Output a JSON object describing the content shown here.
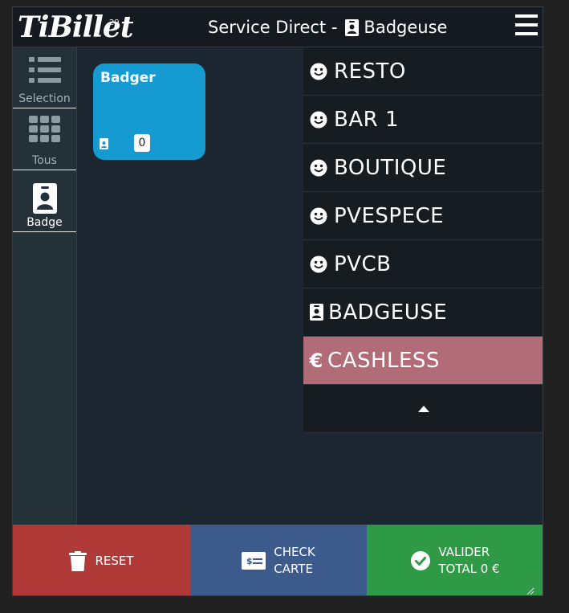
{
  "header": {
    "logo_text": "TiBillet",
    "logo_sup": "29",
    "title_prefix": "Service Direct -",
    "title_suffix": "Badgeuse",
    "menu_icon": "hamburger-menu-icon"
  },
  "sidebar": {
    "items": [
      {
        "label": "Selection",
        "icon": "list-icon",
        "active": false
      },
      {
        "label": "Tous",
        "icon": "grid-icon",
        "active": false
      },
      {
        "label": "Badge",
        "icon": "badge-icon",
        "active": true
      }
    ]
  },
  "tile": {
    "name": "Badger",
    "icon": "badge-icon",
    "count": "0",
    "color": "#159ad1"
  },
  "list": {
    "items": [
      {
        "label": "RESTO",
        "icon": "smile-icon"
      },
      {
        "label": "BAR 1",
        "icon": "smile-icon"
      },
      {
        "label": "BOUTIQUE",
        "icon": "smile-icon"
      },
      {
        "label": "PVESPECE",
        "icon": "smile-icon"
      },
      {
        "label": "PVCB",
        "icon": "smile-icon"
      },
      {
        "label": "BADGEUSE",
        "icon": "badge-icon"
      },
      {
        "label": "CASHLESS",
        "icon": "euro-icon",
        "highlight_color": "#b16c78"
      }
    ],
    "collapse_icon": "caret-up-icon"
  },
  "footer": {
    "reset_label": "RESET",
    "check_line1": "CHECK",
    "check_line2": "CARTE",
    "valider_line1": "VALIDER",
    "valider_line2": "TOTAL 0 €",
    "colors": {
      "reset": "#b03a38",
      "check": "#3c5a8c",
      "valider": "#2f9a46"
    }
  }
}
